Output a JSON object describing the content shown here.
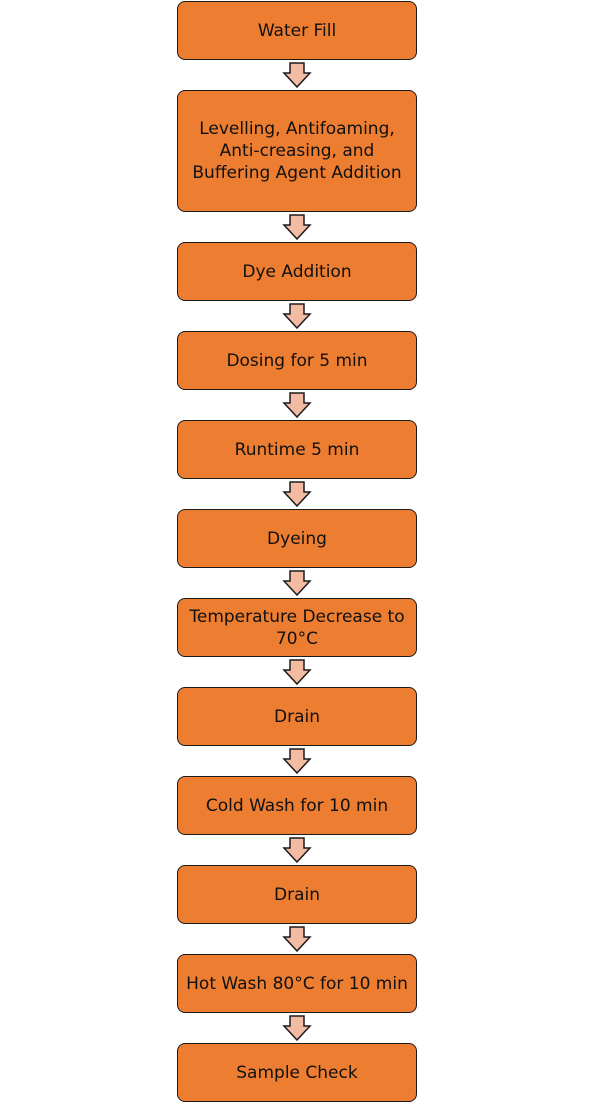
{
  "colors": {
    "box_fill": "#ED7D31",
    "box_border": "#1b1b1b",
    "arrow_fill": "#F4BBA3",
    "arrow_border": "#1b1b1b"
  },
  "steps": [
    {
      "label": "Water Fill"
    },
    {
      "label": "Levelling, Antifoaming, Anti-creasing, and Buffering Agent Addition"
    },
    {
      "label": "Dye Addition"
    },
    {
      "label": "Dosing for 5 min"
    },
    {
      "label": "Runtime 5 min"
    },
    {
      "label": "Dyeing"
    },
    {
      "label": "Temperature Decrease to 70°C"
    },
    {
      "label": "Drain"
    },
    {
      "label": "Cold Wash for 10 min"
    },
    {
      "label": "Drain"
    },
    {
      "label": "Hot Wash 80°C for 10 min"
    },
    {
      "label": "Sample Check"
    }
  ]
}
